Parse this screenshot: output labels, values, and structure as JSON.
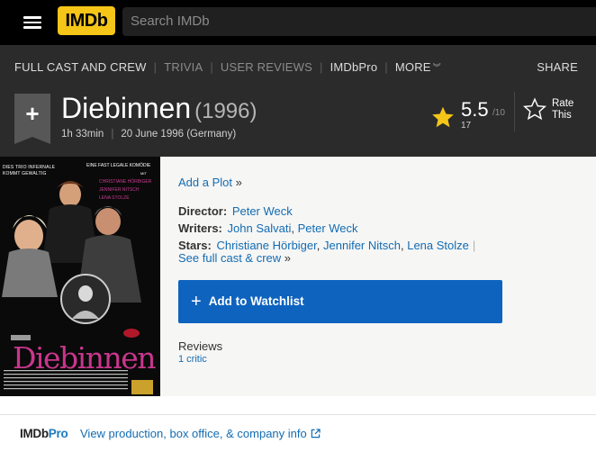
{
  "header": {
    "logo": "IMDb",
    "search_placeholder": "Search IMDb"
  },
  "subnav": {
    "items": [
      {
        "label": "FULL CAST AND CREW",
        "dim": false
      },
      {
        "label": "TRIVIA",
        "dim": true
      },
      {
        "label": "USER REVIEWS",
        "dim": true
      },
      {
        "label": "IMDbPro",
        "dim": false
      },
      {
        "label": "MORE",
        "dim": false
      }
    ],
    "share": "SHARE"
  },
  "title": {
    "name": "Diebinnen",
    "year": "(1996)",
    "runtime": "1h 33min",
    "release": "20 June 1996 (Germany)"
  },
  "rating": {
    "value": "5.5",
    "out_of": "/10",
    "count": "17",
    "rate_line1": "Rate",
    "rate_line2": "This"
  },
  "poster": {
    "top_left_1": "DIES TRIO INFERNALE",
    "top_left_2": "KOMMT GEWALTIG",
    "top_right": "EINE FAST LEGALE KOMÖDIE",
    "mit": "MIT",
    "cast_1": "CHRISTIANE HÖRBIGER",
    "cast_2": "JENNIFER NITSCH",
    "cast_3": "LENA STOLZE",
    "film_title": "Diebinnen"
  },
  "details": {
    "plot_link": "Add a Plot",
    "plot_suffix": " »",
    "director_label": "Director:",
    "director": "Peter Weck",
    "writers_label": "Writers:",
    "writers": [
      "John Salvati",
      "Peter Weck"
    ],
    "stars_label": "Stars:",
    "stars": [
      "Christiane Hörbiger",
      "Jennifer Nitsch",
      "Lena Stolze"
    ],
    "full_cast": "See full cast & crew",
    "full_cast_suffix": " »",
    "watchlist": "Add to Watchlist",
    "reviews_label": "Reviews",
    "critic": "1 critic"
  },
  "footer": {
    "pro_imdb": "IMDb",
    "pro_pro": "Pro",
    "pro_link": "View production, box office, & company info"
  },
  "colors": {
    "accent": "#f5c518",
    "link": "#136cb2",
    "watchlist": "#0e63be"
  }
}
